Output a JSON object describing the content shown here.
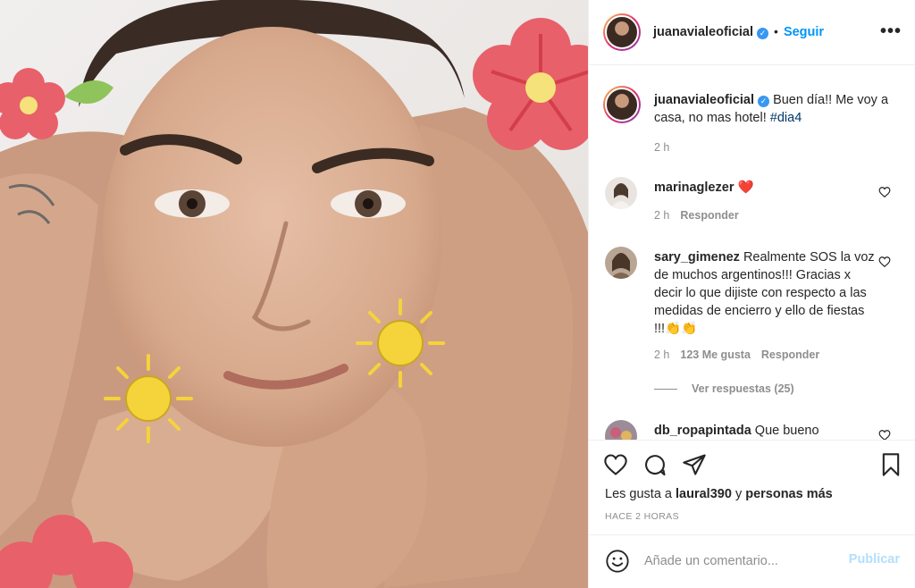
{
  "post": {
    "author": "juanavialeoficial",
    "separator": "•",
    "follow_label": "Seguir",
    "more_icon": "•••",
    "caption_text": "Buen día!! Me voy a casa, no mas hotel!",
    "caption_hashtag": "#dia4",
    "caption_time": "2 h"
  },
  "comments": [
    {
      "user": "marinaglezer",
      "text": "❤️",
      "time": "2 h",
      "reply": "Responder"
    },
    {
      "user": "sary_gimenez",
      "text": "Realmente SOS la voz de muchos argentinos!!! Gracias x decir lo que dijiste con respecto a las medidas de encierro y ello de fiestas !!!👏👏",
      "time": "2 h",
      "likes": "123 Me gusta",
      "reply": "Responder",
      "view_replies": "Ver respuestas (25)"
    },
    {
      "user": "db_ropapintada",
      "text": "Que bueno"
    }
  ],
  "footer": {
    "likes_prefix": "Les gusta a",
    "likes_user": "laural390",
    "likes_mid": "y",
    "likes_others": "personas más",
    "time_ago": "HACE 2 HORAS",
    "comment_placeholder": "Añade un comentario...",
    "publish_label": "Publicar"
  },
  "colors": {
    "link_blue": "#0095f6",
    "verified_blue": "#3897f0",
    "muted": "#8e8e8e",
    "flower_red": "#e8606a",
    "sun_yellow": "#f5d33a"
  }
}
